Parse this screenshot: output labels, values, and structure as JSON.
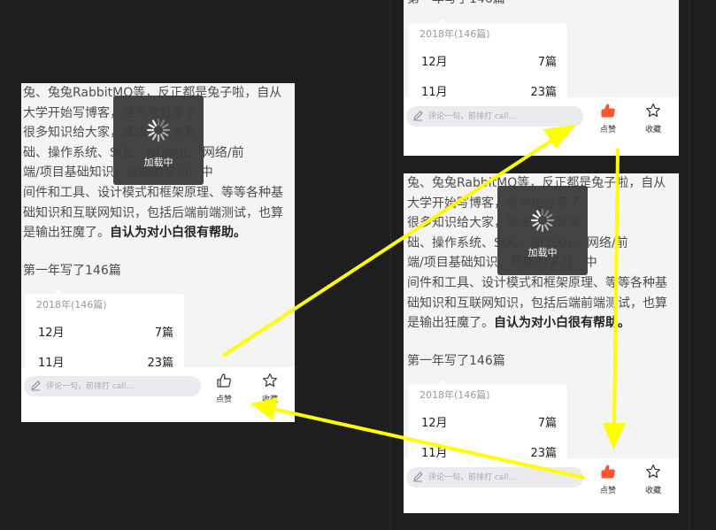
{
  "article": {
    "line1": "兔、兔兔RabbitMQ等，反正都是兔子啦，自从",
    "line2": "大学开始写博客，至今也分享了",
    "line3": "很多知识给大家，算法、语言基",
    "line4": "础、操作系统、SQL、NOSQL、网络/前",
    "line5": "端/项目基础知识，框架的学习、中",
    "line6": "间件和工具、设计模式和框架原理、等等各种基",
    "line7": "础知识和互联网知识，包括后端前端测试，也算",
    "line8_plain": "是输出狂魔了。",
    "line8_bold": "自认为对小白很有帮助。",
    "first_year": "第一年写了146篇"
  },
  "card": {
    "title": "2018年(146篇)",
    "rows": [
      {
        "month": "12月",
        "count": "7篇"
      },
      {
        "month": "11月",
        "count": "23篇"
      }
    ]
  },
  "bottom_bar": {
    "comment_placeholder": "评论一句，前排打 call...",
    "like_label": "点赞",
    "favorite_label": "收藏"
  },
  "loader": {
    "label": "加载中"
  },
  "colors": {
    "like_active": "#fc5531",
    "arrow": "#ffff00",
    "background": "#1e1e1e"
  }
}
